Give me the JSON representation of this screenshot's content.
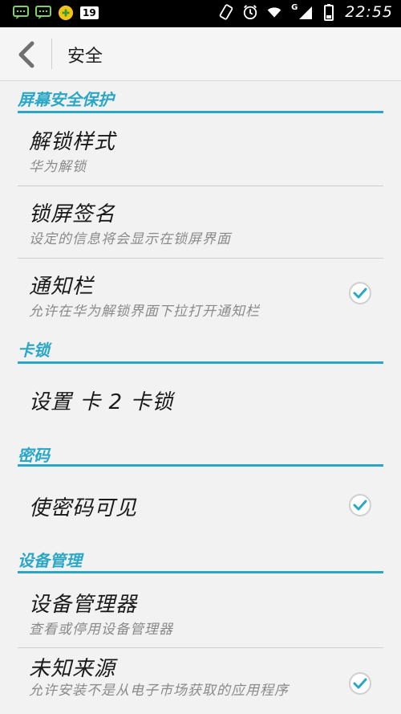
{
  "status_bar": {
    "time": "22:55",
    "network_letter": "G",
    "badge": "19"
  },
  "action_bar": {
    "title": "安全"
  },
  "sections": [
    {
      "header": "屏幕安全保护",
      "items": [
        {
          "title": "解锁样式",
          "subtitle": "华为解锁"
        },
        {
          "title": "锁屏签名",
          "subtitle": "设定的信息将会显示在锁屏界面"
        },
        {
          "title": "通知栏",
          "subtitle": "允许在华为解锁界面下拉打开通知栏",
          "checked": true
        }
      ]
    },
    {
      "header": "卡锁",
      "items": [
        {
          "title": "设置 卡 2 卡锁"
        }
      ]
    },
    {
      "header": "密码",
      "items": [
        {
          "title": "使密码可见",
          "checked": true
        }
      ]
    },
    {
      "header": "设备管理",
      "items": [
        {
          "title": "设备管理器",
          "subtitle": "查看或停用设备管理器"
        },
        {
          "title": "未知来源",
          "subtitle": "允许安装不是从电子市场获取的应用程序",
          "checked": true
        }
      ]
    }
  ],
  "colors": {
    "accent": "#2aa7c7",
    "background": "#f2f2f2"
  }
}
